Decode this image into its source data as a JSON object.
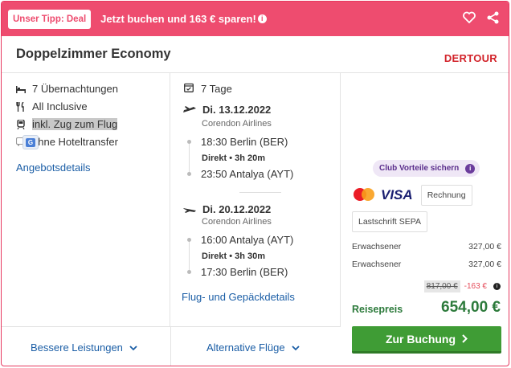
{
  "banner": {
    "tip_label": "Unser Tipp: Deal",
    "text": "Jetzt buchen und 163 € sparen!",
    "info_glyph": "i",
    "icons": [
      "heart-icon",
      "share-icon"
    ]
  },
  "offer": {
    "title": "Doppelzimmer Economy",
    "operator_logo": "DERTOUR"
  },
  "features": [
    {
      "icon": "bed-icon",
      "label": "7 Übernachtungen"
    },
    {
      "icon": "cutlery-icon",
      "label": "All Inclusive"
    },
    {
      "icon": "train-icon",
      "label": "inkl. Zug zum Flug"
    },
    {
      "icon": "bus-icon",
      "label": "ohne Hoteltransfer"
    }
  ],
  "features_link": "Angebotsdetails",
  "flights": {
    "duration": "7 Tage",
    "outbound": {
      "date": "Di. 13.12.2022",
      "airline": "Corendon Airlines",
      "dep": "18:30 Berlin (BER)",
      "direct": "Direkt  •  3h 20m",
      "arr": "23:50 Antalya (AYT)"
    },
    "inbound": {
      "date": "Di. 20.12.2022",
      "airline": "Corendon Airlines",
      "dep": "16:00 Antalya (AYT)",
      "direct": "Direkt  •  3h 30m",
      "arr": "17:30 Berlin (BER)"
    },
    "details_link": "Flug- und Gepäckdetails"
  },
  "bottom": {
    "better_services": "Bessere Leistungen",
    "alt_flights": "Alternative Flüge"
  },
  "pricing": {
    "club": "Club Vorteile sichern",
    "payment": {
      "visa": "VISA",
      "invoice": "Rechnung",
      "sepa": "Lastschrift SEPA"
    },
    "travellers": [
      {
        "label": "Erwachsener",
        "price": "327,00 €"
      },
      {
        "label": "Erwachsener",
        "price": "327,00 €"
      }
    ],
    "old_price": "817,00 €",
    "saving": "-163 €",
    "total_label": "Reisepreis",
    "total": "654,00 €",
    "book_label": "Zur Buchung",
    "colors": {
      "accent": "#ee4c6f",
      "book": "#3f9c35",
      "price": "#2c7a3b",
      "link": "#1b5ea6"
    }
  }
}
